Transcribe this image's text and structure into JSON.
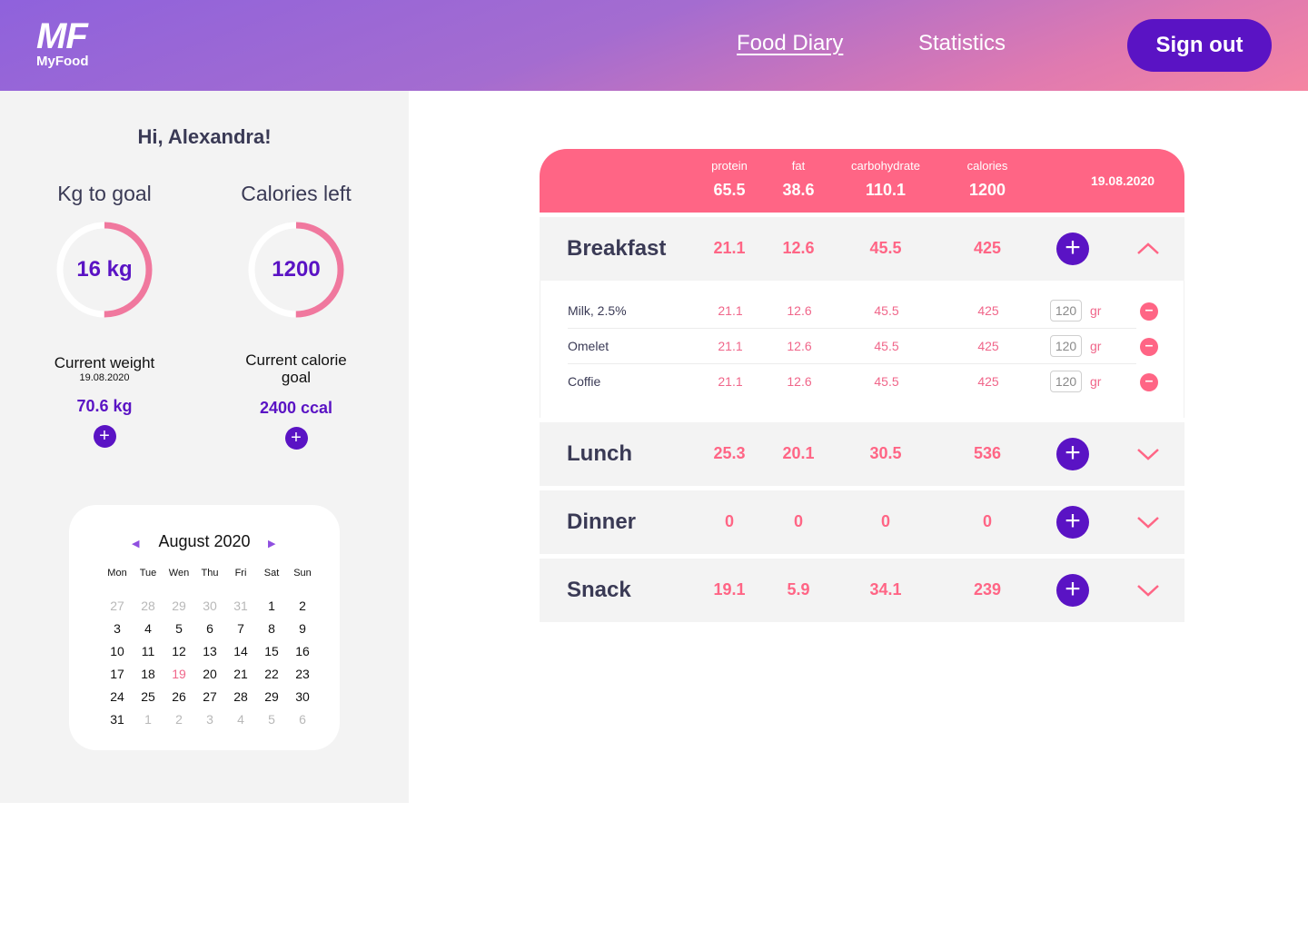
{
  "header": {
    "logo_mark": "MF",
    "logo_text": "MyFood",
    "nav": [
      {
        "label": "Food Diary",
        "active": true
      },
      {
        "label": "Statistics",
        "active": false
      }
    ],
    "signout_label": "Sign out"
  },
  "sidebar": {
    "greeting": "Hi, Alexandra!",
    "kg_goal": {
      "title": "Kg to goal",
      "value": "16 kg",
      "progress": 0.5,
      "sub": "Current weight",
      "date": "19.08.2020",
      "current": "70.6 kg"
    },
    "calories": {
      "title": "Calories left",
      "value": "1200",
      "progress": 0.5,
      "sub": "Current calorie goal",
      "current": "2400 ccal"
    },
    "add_label": "+"
  },
  "calendar": {
    "month": "August 2020",
    "prev": "◀",
    "next": "▶",
    "weekdays": [
      "Mon",
      "Tue",
      "Wen",
      "Thu",
      "Fri",
      "Sat",
      "Sun"
    ],
    "weeks": [
      [
        {
          "d": "27",
          "m": true
        },
        {
          "d": "28",
          "m": true
        },
        {
          "d": "29",
          "m": true
        },
        {
          "d": "30",
          "m": true
        },
        {
          "d": "31",
          "m": true
        },
        {
          "d": "1"
        },
        {
          "d": "2"
        }
      ],
      [
        {
          "d": "3"
        },
        {
          "d": "4"
        },
        {
          "d": "5"
        },
        {
          "d": "6"
        },
        {
          "d": "7"
        },
        {
          "d": "8"
        },
        {
          "d": "9"
        }
      ],
      [
        {
          "d": "10"
        },
        {
          "d": "11"
        },
        {
          "d": "12"
        },
        {
          "d": "13"
        },
        {
          "d": "14"
        },
        {
          "d": "15"
        },
        {
          "d": "16"
        }
      ],
      [
        {
          "d": "17"
        },
        {
          "d": "18"
        },
        {
          "d": "19",
          "t": true
        },
        {
          "d": "20"
        },
        {
          "d": "21"
        },
        {
          "d": "22"
        },
        {
          "d": "23"
        }
      ],
      [
        {
          "d": "24"
        },
        {
          "d": "25"
        },
        {
          "d": "26"
        },
        {
          "d": "27"
        },
        {
          "d": "28"
        },
        {
          "d": "29"
        },
        {
          "d": "30"
        }
      ],
      [
        {
          "d": "31"
        },
        {
          "d": "1",
          "m": true
        },
        {
          "d": "2",
          "m": true
        },
        {
          "d": "3",
          "m": true
        },
        {
          "d": "4",
          "m": true
        },
        {
          "d": "5",
          "m": true
        },
        {
          "d": "6",
          "m": true
        }
      ]
    ]
  },
  "totals": {
    "columns": [
      {
        "label": "protein",
        "value": "65.5"
      },
      {
        "label": "fat",
        "value": "38.6"
      },
      {
        "label": "carbohydrate",
        "value": "110.1"
      },
      {
        "label": "calories",
        "value": "1200"
      }
    ],
    "date": "19.08.2020"
  },
  "meals": [
    {
      "name": "Breakfast",
      "values": [
        "21.1",
        "12.6",
        "45.5",
        "425"
      ],
      "expanded": true,
      "items": [
        {
          "name": "Milk, 2.5%",
          "values": [
            "21.1",
            "12.6",
            "45.5",
            "425"
          ],
          "qty": "120",
          "unit": "gr"
        },
        {
          "name": "Omelet",
          "values": [
            "21.1",
            "12.6",
            "45.5",
            "425"
          ],
          "qty": "120",
          "unit": "gr"
        },
        {
          "name": "Coffie",
          "values": [
            "21.1",
            "12.6",
            "45.5",
            "425"
          ],
          "qty": "120",
          "unit": "gr"
        }
      ]
    },
    {
      "name": "Lunch",
      "values": [
        "25.3",
        "20.1",
        "30.5",
        "536"
      ],
      "expanded": false,
      "items": []
    },
    {
      "name": "Dinner",
      "values": [
        "0",
        "0",
        "0",
        "0"
      ],
      "expanded": false,
      "items": []
    },
    {
      "name": "Snack",
      "values": [
        "19.1",
        "5.9",
        "34.1",
        "239"
      ],
      "expanded": false,
      "items": []
    }
  ],
  "colors": {
    "accent": "#5a13c4",
    "pink": "#ff6585",
    "ring": "#f0789e"
  }
}
